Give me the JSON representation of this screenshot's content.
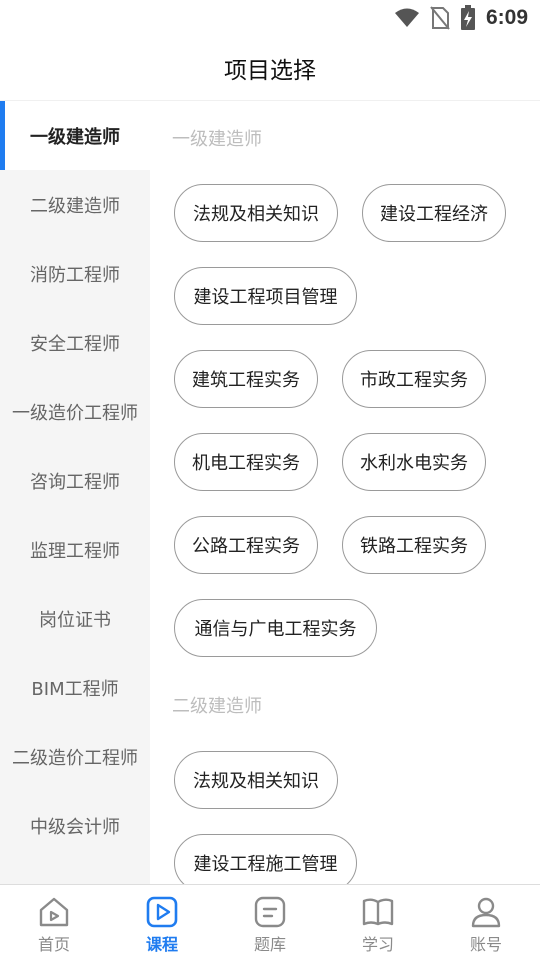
{
  "status_bar": {
    "time": "6:09",
    "icons": [
      "wifi-icon",
      "no-sim-icon",
      "battery-charging-icon"
    ]
  },
  "header": {
    "title": "项目选择"
  },
  "sidebar": {
    "items": [
      {
        "label": "一级建造师",
        "active": true
      },
      {
        "label": "二级建造师",
        "active": false
      },
      {
        "label": "消防工程师",
        "active": false
      },
      {
        "label": "安全工程师",
        "active": false
      },
      {
        "label": "一级造价工程师",
        "active": false
      },
      {
        "label": "咨询工程师",
        "active": false
      },
      {
        "label": "监理工程师",
        "active": false
      },
      {
        "label": "岗位证书",
        "active": false
      },
      {
        "label": "BIM工程师",
        "active": false
      },
      {
        "label": "二级造价工程师",
        "active": false
      },
      {
        "label": "中级会计师",
        "active": false
      }
    ]
  },
  "main": {
    "sections": [
      {
        "title": "一级建造师",
        "chips": [
          "法规及相关知识",
          "建设工程经济",
          "建设工程项目管理",
          "建筑工程实务",
          "市政工程实务",
          "机电工程实务",
          "水利水电实务",
          "公路工程实务",
          "铁路工程实务",
          "通信与广电工程实务"
        ]
      },
      {
        "title": "二级建造师",
        "chips": [
          "法规及相关知识",
          "建设工程施工管理"
        ]
      }
    ]
  },
  "bottom_nav": {
    "items": [
      {
        "label": "首页",
        "icon": "home-icon",
        "active": false
      },
      {
        "label": "课程",
        "icon": "course-play-icon",
        "active": true
      },
      {
        "label": "题库",
        "icon": "question-bank-icon",
        "active": false
      },
      {
        "label": "学习",
        "icon": "book-icon",
        "active": false
      },
      {
        "label": "账号",
        "icon": "account-icon",
        "active": false
      }
    ]
  },
  "colors": {
    "accent": "#1f7cf0",
    "inactive_nav": "#8a8a8a"
  }
}
